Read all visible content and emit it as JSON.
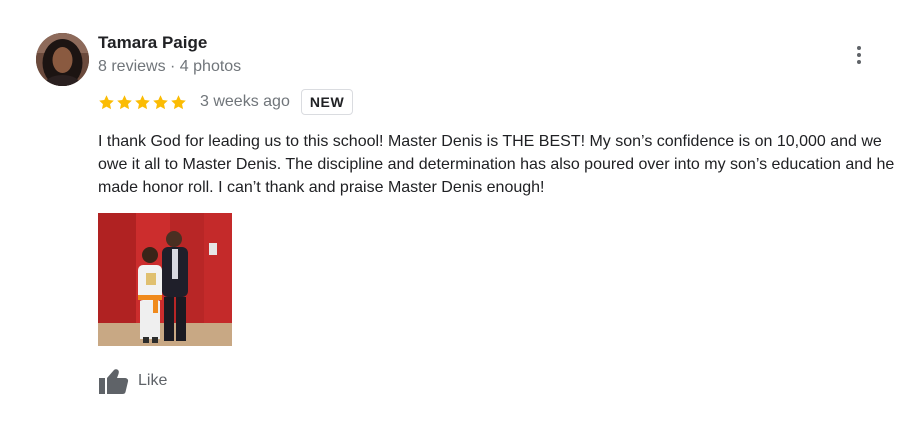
{
  "review": {
    "author_name": "Tamara Paige",
    "author_meta": "8 reviews · 4 photos",
    "rating": 5,
    "rating_max": 5,
    "star_color": "#fbbc04",
    "time": "3 weeks ago",
    "badge": "NEW",
    "text": "I thank God for leading us to this school! Master Denis is THE BEST! My son’s confidence is on 10,000 and we owe it all to Master Denis. The discipline and determination has also poured over into my son’s education and he made honor roll. I can’t thank and praise Master Denis enough!",
    "photo_count": 1
  },
  "actions": {
    "more_icon": "more-vert-icon",
    "like_icon": "thumb-up-icon",
    "like_label": "Like"
  }
}
